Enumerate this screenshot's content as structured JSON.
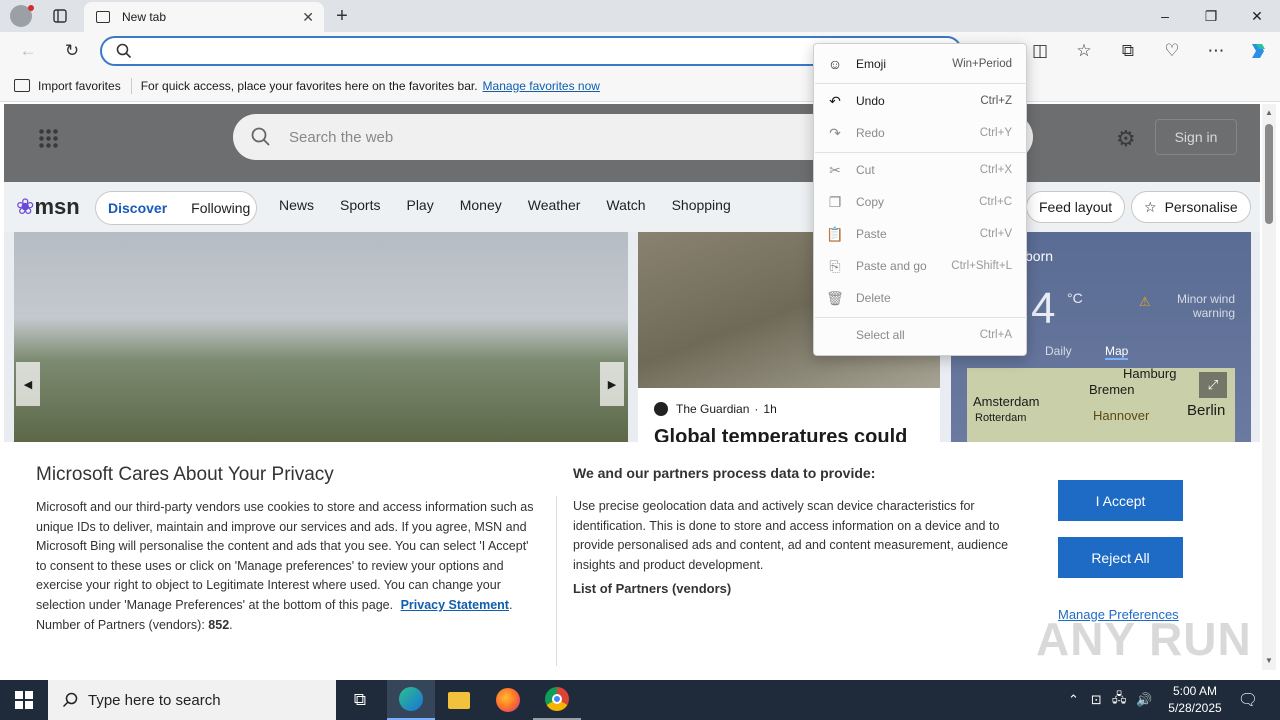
{
  "browser": {
    "tab_title": "New tab",
    "address_value": "",
    "favorites": {
      "import_label": "Import favorites",
      "hint": "For quick access, place your favorites here on the favorites bar.",
      "manage_link": "Manage favorites now"
    }
  },
  "msn": {
    "search_placeholder": "Search the web",
    "sign_in": "Sign in",
    "logo": "msn",
    "tabs": [
      "Discover",
      "Following"
    ],
    "nav": [
      "News",
      "Sports",
      "Play",
      "Money",
      "Weather",
      "Watch",
      "Shopping"
    ],
    "feed_layout": "Feed layout",
    "personalise": "Personalise",
    "card2": {
      "source": "The Guardian",
      "time": "1h",
      "headline": "Global temperatures could"
    },
    "weather": {
      "location": "born",
      "temp": "4",
      "unit": "°C",
      "warning": "Minor wind warning",
      "tabs": [
        "Daily",
        "Map"
      ],
      "map_labels": [
        "Hamburg",
        "Bremen",
        "Amsterdam",
        "Rotterdam",
        "Hannover",
        "Berlin"
      ]
    }
  },
  "context_menu": {
    "items": [
      {
        "label": "Emoji",
        "shortcut": "Win+Period",
        "icon": "emoji-icon",
        "enabled": true
      },
      {
        "label": "Undo",
        "shortcut": "Ctrl+Z",
        "icon": "undo-icon",
        "enabled": true
      },
      {
        "label": "Redo",
        "shortcut": "Ctrl+Y",
        "icon": "redo-icon",
        "enabled": false
      },
      {
        "label": "Cut",
        "shortcut": "Ctrl+X",
        "icon": "cut-icon",
        "enabled": false
      },
      {
        "label": "Copy",
        "shortcut": "Ctrl+C",
        "icon": "copy-icon",
        "enabled": false
      },
      {
        "label": "Paste",
        "shortcut": "Ctrl+V",
        "icon": "paste-icon",
        "enabled": false
      },
      {
        "label": "Paste and go",
        "shortcut": "Ctrl+Shift+L",
        "icon": "paste-go-icon",
        "enabled": false
      },
      {
        "label": "Delete",
        "shortcut": "",
        "icon": "delete-icon",
        "enabled": false
      },
      {
        "label": "Select all",
        "shortcut": "Ctrl+A",
        "icon": "",
        "enabled": false
      }
    ]
  },
  "privacy": {
    "title": "Microsoft Cares About Your Privacy",
    "body": "Microsoft and our third-party vendors use cookies to store and access information such as unique IDs to deliver, maintain and improve our services and ads. If you agree, MSN and Microsoft Bing will personalise the content and ads that you see. You can select 'I Accept' to consent to these uses or click on 'Manage preferences' to review your options and exercise your right to object to Legitimate Interest where used. You can change your selection under 'Manage Preferences' at the bottom of this page.",
    "privacy_link": "Privacy Statement",
    "partners_label": "Number of Partners (vendors):",
    "partners_count": "852",
    "right_title": "We and our partners process data to provide:",
    "right_body": "Use precise geolocation data and actively scan device characteristics for identification. This is done to store and access information on a device and to provide personalised ads and content, ad and content measurement, audience insights and product development.",
    "list_link": "List of Partners (vendors)",
    "accept": "I Accept",
    "reject": "Reject All",
    "manage": "Manage Preferences"
  },
  "taskbar": {
    "search_placeholder": "Type here to search",
    "time": "5:00 AM",
    "date": "5/28/2025"
  },
  "watermark": "ANY RUN",
  "colors": {
    "accent": "#1e6bc5",
    "link": "#0f5fad",
    "address_focus": "#3a78c9"
  }
}
